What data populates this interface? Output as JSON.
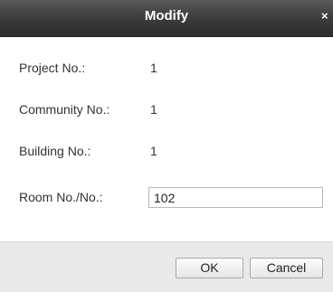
{
  "dialog": {
    "title": "Modify",
    "close_glyph": "×"
  },
  "fields": {
    "project": {
      "label": "Project No.:",
      "value": "1"
    },
    "community": {
      "label": "Community No.:",
      "value": "1"
    },
    "building": {
      "label": "Building No.:",
      "value": "1"
    },
    "room": {
      "label": "Room No./No.:",
      "value": "102"
    }
  },
  "buttons": {
    "ok_label": "OK",
    "cancel_label": "Cancel"
  },
  "colors": {
    "titlebar": "#3a3a3a",
    "footer": "#e9e9e9"
  }
}
